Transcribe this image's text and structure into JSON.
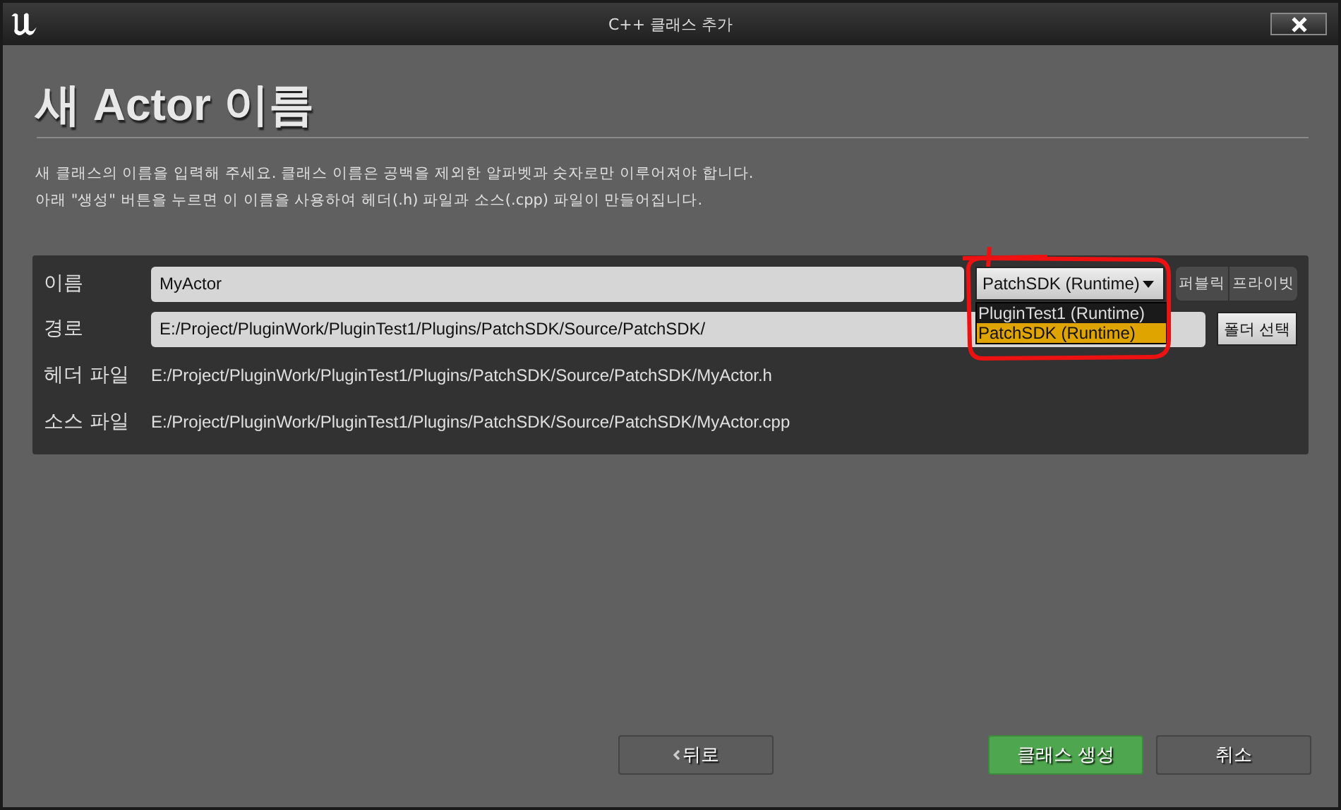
{
  "window": {
    "title": "C++ 클래스 추가"
  },
  "heading": "새 Actor 이름",
  "description": [
    "새 클래스의 이름을 입력해 주세요. 클래스 이름은 공백을 제외한 알파벳과 숫자로만 이루어져야 합니다.",
    "아래 \"생성\" 버튼을 누르면 이 이름을 사용하여 헤더(.h) 파일과 소스(.cpp) 파일이 만들어집니다."
  ],
  "name_row": {
    "label": "이름",
    "value": "MyActor",
    "module": "PatchSDK (Runtime)",
    "access": [
      "퍼블릭",
      "프라이빗"
    ]
  },
  "module_options": [
    {
      "label": "PluginTest1 (Runtime)",
      "selected": false
    },
    {
      "label": "PatchSDK (Runtime)",
      "selected": true
    }
  ],
  "path_row": {
    "label": "경로",
    "value": "E:/Project/PluginWork/PluginTest1/Plugins/PatchSDK/Source/PatchSDK/",
    "button": "폴더 선택"
  },
  "header_row": {
    "label": "헤더 파일",
    "value": "E:/Project/PluginWork/PluginTest1/Plugins/PatchSDK/Source/PatchSDK/MyActor.h"
  },
  "source_row": {
    "label": "소스 파일",
    "value": "E:/Project/PluginWork/PluginTest1/Plugins/PatchSDK/Source/PatchSDK/MyActor.cpp"
  },
  "buttons": {
    "back": "뒤로",
    "create": "클래스 생성",
    "cancel": "취소"
  }
}
